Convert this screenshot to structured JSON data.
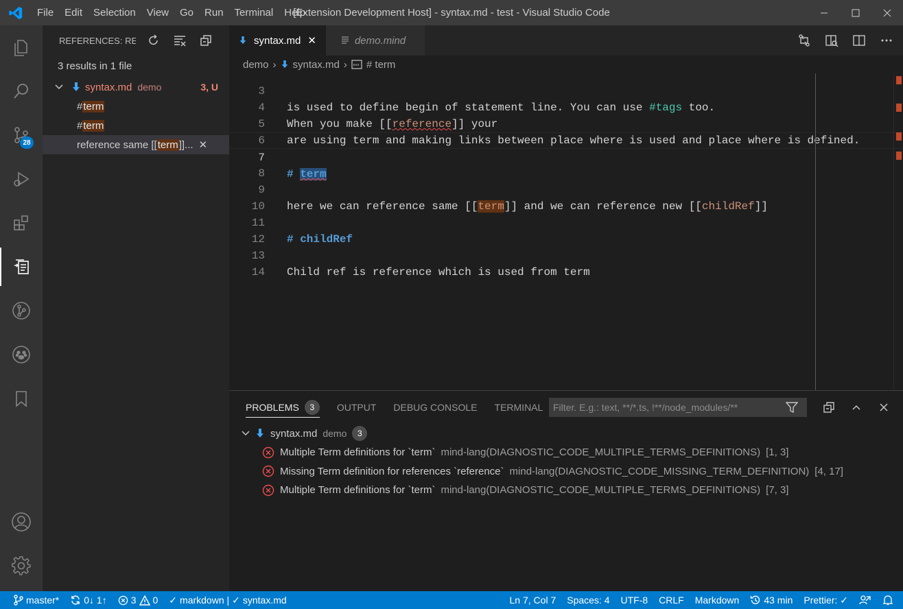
{
  "titlebar": {
    "menu": [
      "File",
      "Edit",
      "Selection",
      "View",
      "Go",
      "Run",
      "Terminal",
      "Help"
    ],
    "window_title": "[Extension Development Host] - syntax.md - test - Visual Studio Code"
  },
  "activitybar": {
    "icons": [
      "explorer-icon",
      "search-icon",
      "source-control-icon",
      "run-debug-icon",
      "extensions-icon",
      "references-icon",
      "git-graph-icon",
      "paw-icon",
      "bookmarks-icon",
      "account-icon",
      "settings-gear-icon"
    ],
    "scm_badge": "28"
  },
  "sidebar": {
    "title": "REFERENCES: RE...",
    "summary": "3 results in 1 file",
    "file": {
      "name": "syntax.md",
      "desc": "demo",
      "count": "3, U"
    },
    "refs": [
      {
        "prefix": "# ",
        "hit": "term",
        "suffix": ""
      },
      {
        "prefix": "# ",
        "hit": "term",
        "suffix": ""
      },
      {
        "prefix": "reference same [[",
        "hit": "term",
        "suffix": "]]..."
      }
    ]
  },
  "tabs": [
    {
      "label": "syntax.md",
      "active": true
    },
    {
      "label": "demo.mind",
      "active": false
    }
  ],
  "breadcrumb": {
    "folder": "demo",
    "file": "syntax.md",
    "symbol": "# term"
  },
  "editor": {
    "lines": [
      {
        "n": "3",
        "text": "is used to define begin of statement line. You can use #tags too."
      },
      {
        "n": "4",
        "pre": "When you make [[",
        "link": "reference",
        "post": "]] your"
      },
      {
        "n": "5",
        "text": "are using term and making links between place where is used and place where is defined."
      },
      {
        "n": "6",
        "text": ""
      },
      {
        "n": "7",
        "hash": "# ",
        "heading": "term"
      },
      {
        "n": "8",
        "text": ""
      },
      {
        "n": "9",
        "pre": "here we can reference same [[",
        "link": "term",
        "mid": "]] and we can reference new [[",
        "link2": "childRef",
        "post": "]]"
      },
      {
        "n": "10",
        "text": ""
      },
      {
        "n": "11",
        "heading_full": "# childRef"
      },
      {
        "n": "12",
        "text": ""
      },
      {
        "n": "13",
        "text": "Child ref is reference which is used from term"
      },
      {
        "n": "14",
        "text": ""
      }
    ]
  },
  "panel": {
    "tabs": [
      "PROBLEMS",
      "OUTPUT",
      "DEBUG CONSOLE",
      "TERMINAL"
    ],
    "problems_count": "3",
    "filter_placeholder": "Filter. E.g.: text, **/*.ts, !**/node_modules/**",
    "file": {
      "name": "syntax.md",
      "desc": "demo",
      "count": "3"
    },
    "problems": [
      {
        "msg": "Multiple Term definitions for `term`",
        "src": "mind-lang(DIAGNOSTIC_CODE_MULTIPLE_TERMS_DEFINITIONS)",
        "pos": "[1, 3]"
      },
      {
        "msg": "Missing Term definition for references `reference`",
        "src": "mind-lang(DIAGNOSTIC_CODE_MISSING_TERM_DEFINITION)",
        "pos": "[4, 17]"
      },
      {
        "msg": "Multiple Term definitions for `term`",
        "src": "mind-lang(DIAGNOSTIC_CODE_MULTIPLE_TERMS_DEFINITIONS)",
        "pos": "[7, 3]"
      }
    ]
  },
  "statusbar": {
    "branch": "master*",
    "sync": "0↓ 1↑",
    "errors": "3",
    "warnings": "0",
    "lang_check": "markdown | ",
    "file_check": "syntax.md",
    "cursor": "Ln 7, Col 7",
    "spaces": "Spaces: 4",
    "encoding": "UTF-8",
    "eol": "CRLF",
    "language": "Markdown",
    "time": "43 min",
    "prettier": "Prettier: ✓"
  },
  "colors": {
    "accent": "#007acc",
    "error": "#f14c4c",
    "heading": "#569cd6",
    "link": "#ce9178"
  }
}
